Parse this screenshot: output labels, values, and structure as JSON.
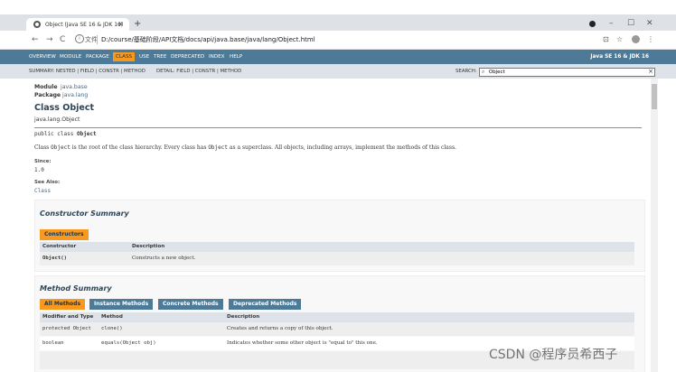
{
  "browser": {
    "tab_title": "Object (Java SE 16 & JDK 16)",
    "tab_close": "×",
    "new_tab": "+",
    "address_label": "文件",
    "url": "D:/course/基础阶段/API文档/docs/api/java.base/java/lang/Object.html",
    "back_glyph": "←",
    "forward_glyph": "→",
    "reload_glyph": "C",
    "minimize_glyph": "–",
    "restore_glyph": "☐",
    "close_glyph": "✕",
    "translate_glyph": "⊡",
    "star_glyph": "☆",
    "menu_glyph": "⋮"
  },
  "topnav": {
    "items": [
      {
        "label": "OVERVIEW",
        "active": false
      },
      {
        "label": "MODULE",
        "active": false
      },
      {
        "label": "PACKAGE",
        "active": false
      },
      {
        "label": "CLASS",
        "active": true
      },
      {
        "label": "USE",
        "active": false
      },
      {
        "label": "TREE",
        "active": false
      },
      {
        "label": "DEPRECATED",
        "active": false
      },
      {
        "label": "INDEX",
        "active": false
      },
      {
        "label": "HELP",
        "active": false
      }
    ],
    "version": "Java SE 16 & JDK 16"
  },
  "subnav": {
    "summary_text": "SUMMARY: NESTED | FIELD | CONSTR | METHOD",
    "detail_text": "DETAIL: FIELD | CONSTR | METHOD",
    "search_label": "SEARCH:",
    "search_value": "Object",
    "search_clear": "×"
  },
  "header": {
    "module_label": "Module",
    "module_value": "java.base",
    "package_label": "Package",
    "package_value": "java.lang",
    "class_title": "Class Object",
    "inheritance": "java.lang.Object",
    "declaration_prefix": "public class ",
    "declaration_name": "Object"
  },
  "description": {
    "p1": "Class ",
    "p1_code": "Object",
    "p2": " is the root of the class hierarchy. Every class has ",
    "p2_code": "Object",
    "p3": " as a superclass. All objects, including arrays, implement the methods of this class.",
    "since_label": "Since:",
    "since_value": "1.0",
    "see_also_label": "See Also:",
    "see_also_value": "Class"
  },
  "constructor_summary": {
    "title": "Constructor Summary",
    "caption": "Constructors",
    "columns": [
      "Constructor",
      "Description"
    ],
    "rows": [
      {
        "name": "Object()",
        "desc": "Constructs a new object."
      }
    ]
  },
  "method_summary": {
    "title": "Method Summary",
    "tabs": [
      {
        "label": "All Methods",
        "active": true
      },
      {
        "label": "Instance Methods",
        "active": false
      },
      {
        "label": "Concrete Methods",
        "active": false
      },
      {
        "label": "Deprecated Methods",
        "active": false
      }
    ],
    "columns": [
      "Modifier and Type",
      "Method",
      "Description"
    ],
    "rows": [
      {
        "modifier": "protected Object",
        "method": "clone()",
        "desc": "Creates and returns a copy of this object."
      },
      {
        "modifier": "boolean",
        "method": "equals(Object obj)",
        "desc": "Indicates whether some other object is \"equal to\" this one."
      }
    ]
  },
  "watermark": "CSDN @程序员希西子",
  "colors": {
    "nav": "#4d7a97",
    "active": "#f8981d",
    "subnav": "#dee3e9"
  }
}
